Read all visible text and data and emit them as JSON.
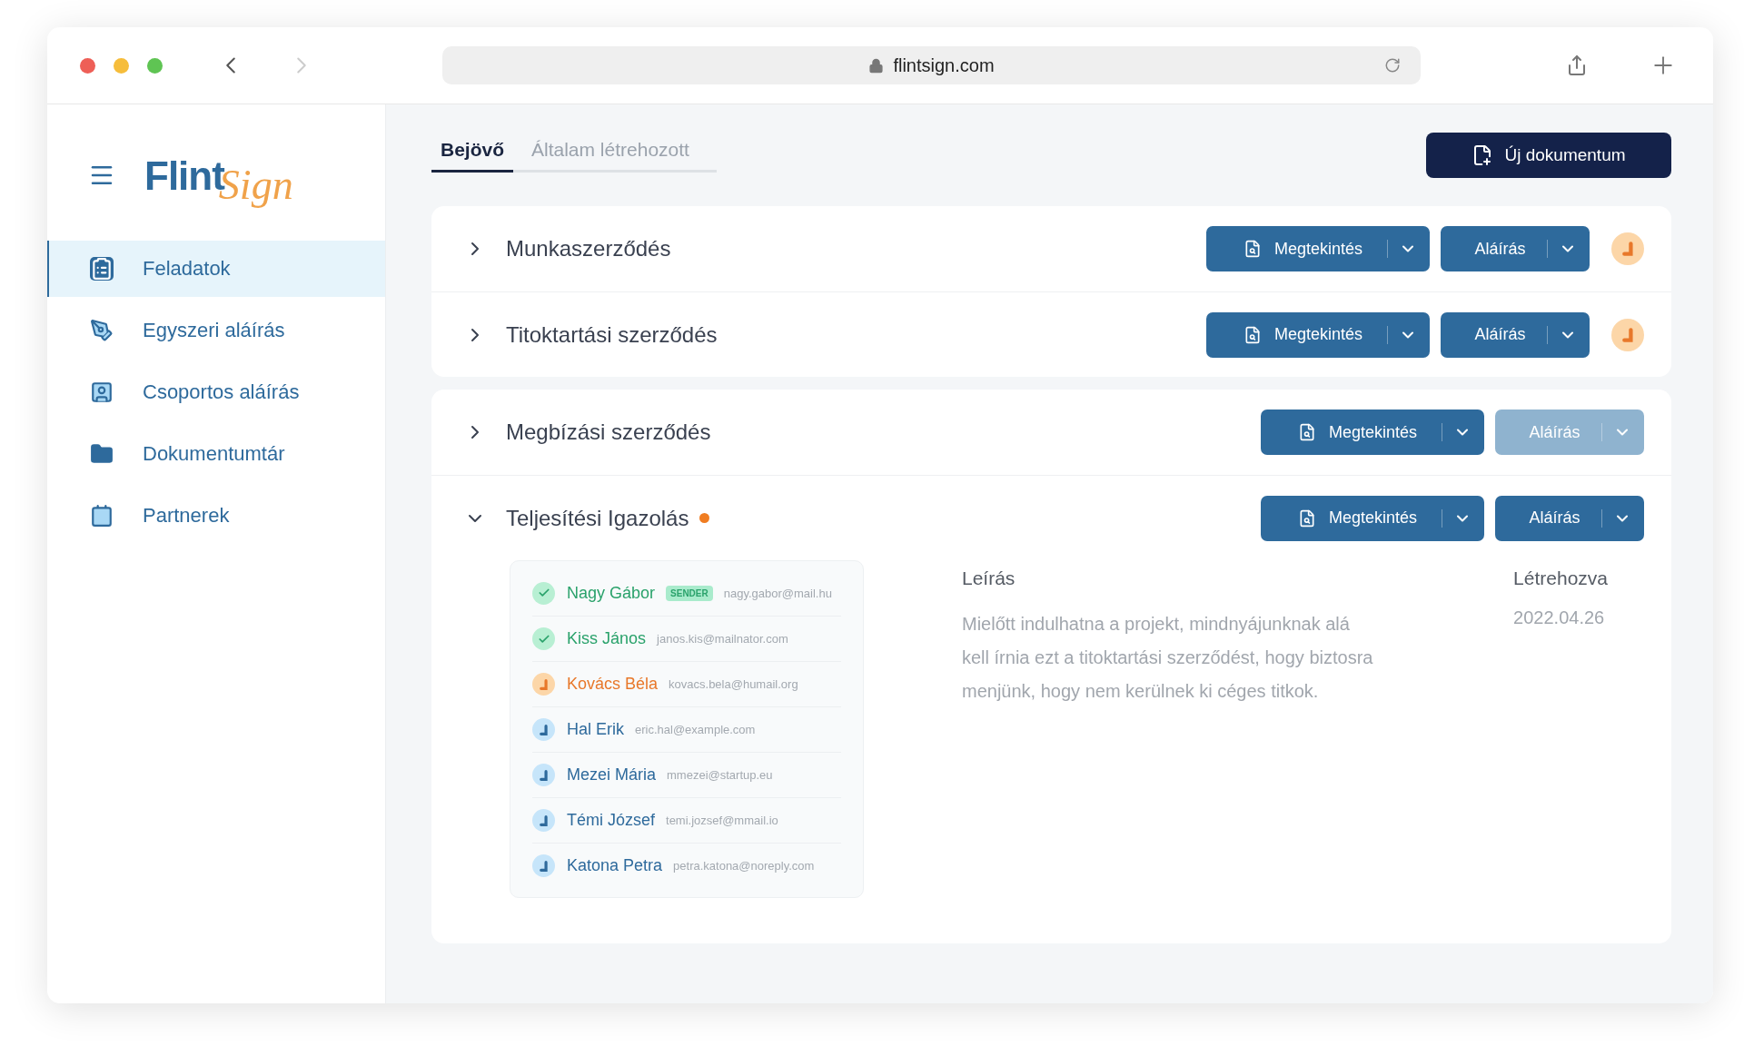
{
  "browser": {
    "url": "flintsign.com"
  },
  "logo": {
    "main": "Flint",
    "script": "Sign"
  },
  "sidebar": {
    "items": [
      {
        "label": "Feladatok",
        "kind": "tasks",
        "selected": true
      },
      {
        "label": "Egyszeri aláírás",
        "kind": "pen",
        "selected": false
      },
      {
        "label": "Csoportos aláírás",
        "kind": "group",
        "selected": false
      },
      {
        "label": "Dokumentumtár",
        "kind": "folder",
        "selected": false
      },
      {
        "label": "Partnerek",
        "kind": "contacts",
        "selected": false
      }
    ]
  },
  "tabs": [
    {
      "label": "Bejövő",
      "selected": true
    },
    {
      "label": "Általam létrehozott",
      "selected": false
    }
  ],
  "new_button": "Új dokumentum",
  "groups": [
    [
      {
        "title": "Munkaszerződés",
        "expanded": false,
        "unread": false,
        "view_label": "Megtekintés",
        "sign_label": "Aláírás",
        "sign_disabled": false,
        "pending": true
      },
      {
        "title": "Titoktartási szerződés",
        "expanded": false,
        "unread": false,
        "view_label": "Megtekintés",
        "sign_label": "Aláírás",
        "sign_disabled": false,
        "pending": true
      }
    ],
    [
      {
        "title": "Megbízási szerződés",
        "expanded": false,
        "unread": false,
        "view_label": "Megtekintés",
        "sign_label": "Aláírás",
        "sign_disabled": true,
        "pending": false
      },
      {
        "title": "Teljesítési Igazolás",
        "expanded": true,
        "unread": true,
        "view_label": "Megtekintés",
        "sign_label": "Aláírás",
        "sign_disabled": false,
        "pending": false,
        "details": {
          "signers": [
            {
              "name": "Nagy Gábor",
              "badge": "SENDER",
              "email": "nagy.gabor@mail.hu",
              "signed": true,
              "active": false
            },
            {
              "name": "Kiss János",
              "email": "janos.kis@mailnator.com",
              "signed": true,
              "active": false
            },
            {
              "name": "Kovács Béla",
              "email": "kovacs.bela@humail.org",
              "signed": false,
              "active": true
            },
            {
              "name": "Hal Erik",
              "email": "eric.hal@example.com",
              "signed": false,
              "active": false
            },
            {
              "name": "Mezei Mária",
              "email": "mmezei@startup.eu",
              "signed": false,
              "active": false
            },
            {
              "name": "Témi József",
              "email": "temi.jozsef@mmail.io",
              "signed": false,
              "active": false
            },
            {
              "name": "Katona Petra",
              "email": "petra.katona@noreply.com",
              "signed": false,
              "active": false
            }
          ],
          "description_label": "Leírás",
          "description": "Mielőtt indulhatna a projekt, mindnyájunknak alá kell írnia ezt a titoktartási szerződést, hogy biztosra menjünk, hogy nem kerülnek ki céges titkok.",
          "created_label": "Létrehozva",
          "created": "2022.04.26"
        }
      }
    ]
  ]
}
